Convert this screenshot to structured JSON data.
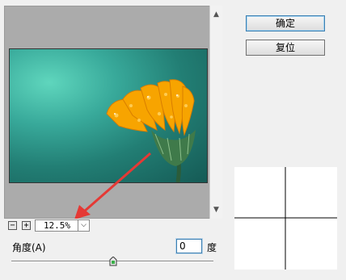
{
  "buttons": {
    "ok_label": "确定",
    "reset_label": "复位"
  },
  "zoom": {
    "minus_label": "−",
    "plus_label": "+",
    "value": "12.5%"
  },
  "angle": {
    "label": "角度(A)",
    "value": "0",
    "unit": "度"
  },
  "icons": [
    "zoom-out-icon",
    "zoom-in-icon",
    "chevron-down-icon",
    "scroll-up-arrow-icon",
    "scroll-down-arrow-icon",
    "slider-thumb-icon",
    "red-arrow-annotation-icon"
  ],
  "colors": {
    "accent": "#3c7fb1",
    "annotation": "#e53935",
    "flower": "#f5a300",
    "background_teal": "#2a9485"
  }
}
